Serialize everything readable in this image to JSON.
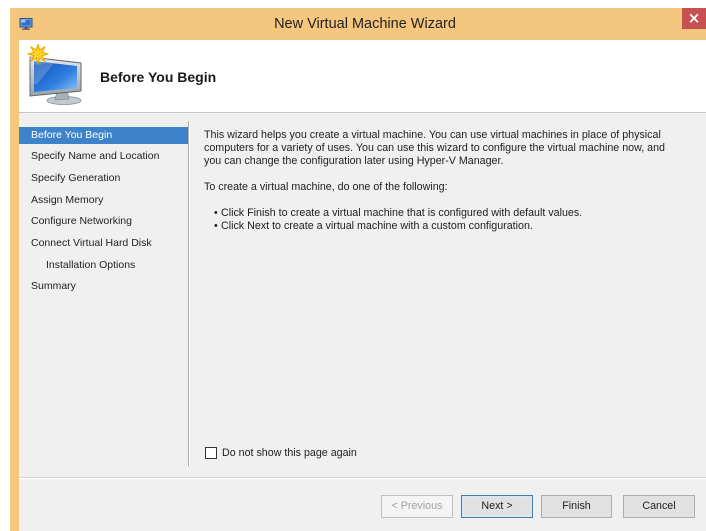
{
  "window": {
    "title": "New Virtual Machine Wizard",
    "icon": "hyper-v-icon",
    "close_glyph": "×"
  },
  "header": {
    "title": "Before You Begin",
    "icon": "new-virtual-machine-icon"
  },
  "nav": {
    "items": [
      {
        "label": "Before You Begin",
        "selected": true
      },
      {
        "label": "Specify Name and Location",
        "selected": false
      },
      {
        "label": "Specify Generation",
        "selected": false
      },
      {
        "label": "Assign Memory",
        "selected": false
      },
      {
        "label": "Configure Networking",
        "selected": false
      },
      {
        "label": "Connect Virtual Hard Disk",
        "selected": false
      },
      {
        "label": "Installation Options",
        "selected": false
      },
      {
        "label": "Summary",
        "selected": false
      }
    ]
  },
  "content": {
    "intro_lines": [
      "This wizard helps you create a virtual machine. You can use virtual machines in place of physical",
      "computers for a variety of uses. You can use this wizard to configure the virtual machine now, and",
      "you can change the configuration later using Hyper-V Manager."
    ],
    "instruction": "To create a virtual machine, do one of the following:",
    "bullet_glyph": "•",
    "bullets": [
      "Click Finish to create a virtual machine that is configured with default values.",
      "Click Next to create a virtual machine with a custom configuration."
    ]
  },
  "options": {
    "dont_show_again": {
      "label": "Do not show this page again",
      "checked": false
    }
  },
  "buttons": {
    "previous": {
      "label": "< Previous",
      "enabled": false
    },
    "next": {
      "label": "Next >",
      "enabled": true,
      "default": true
    },
    "finish": {
      "label": "Finish",
      "enabled": true
    },
    "cancel": {
      "label": "Cancel",
      "enabled": true
    }
  },
  "colors": {
    "frame": "#F4C67E",
    "close_button": "#C75050",
    "selection": "#3C83C9",
    "panel": "#F0F0F0",
    "header": "#FFFFFF",
    "default_button_border": "#3C7FB1"
  }
}
